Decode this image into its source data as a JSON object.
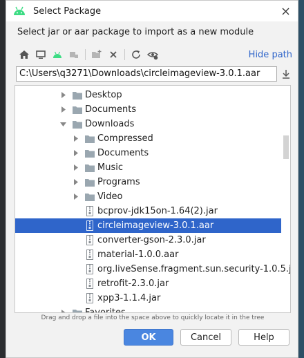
{
  "dialog": {
    "title": "Select Package",
    "instruction": "Select jar or aar package to import as a new module",
    "hide_path": "Hide path",
    "path": "C:\\Users\\q3271\\Downloads\\circleimageview-3.0.1.aar",
    "hint": "Drag and drop a file into the space above to quickly locate it in the tree"
  },
  "toolbar": {
    "icons": [
      "home-icon",
      "desktop-icon",
      "android-icon",
      "module-icon",
      "new-folder-icon",
      "delete-icon",
      "refresh-icon",
      "show-hidden-icon"
    ]
  },
  "tree": {
    "rows": [
      {
        "label": "Desktop",
        "kind": "folder",
        "expanded": false
      },
      {
        "label": "Documents",
        "kind": "folder",
        "expanded": false
      },
      {
        "label": "Downloads",
        "kind": "folder",
        "expanded": true
      },
      {
        "label": "Compressed",
        "kind": "folder",
        "expanded": false
      },
      {
        "label": "Documents",
        "kind": "folder",
        "expanded": false
      },
      {
        "label": "Music",
        "kind": "folder",
        "expanded": false
      },
      {
        "label": "Programs",
        "kind": "folder",
        "expanded": false
      },
      {
        "label": "Video",
        "kind": "folder",
        "expanded": false
      },
      {
        "label": "bcprov-jdk15on-1.64(2).jar",
        "kind": "file"
      },
      {
        "label": "circleimageview-3.0.1.aar",
        "kind": "file",
        "selected": true
      },
      {
        "label": "converter-gson-2.3.0.jar",
        "kind": "file"
      },
      {
        "label": "material-1.0.0.aar",
        "kind": "file"
      },
      {
        "label": "org.liveSense.fragment.sun.security-1.0.5.jar",
        "kind": "file"
      },
      {
        "label": "retrofit-2.3.0.jar",
        "kind": "file"
      },
      {
        "label": "xpp3-1.1.4.jar",
        "kind": "file"
      },
      {
        "label": "Favorites",
        "kind": "folder",
        "expanded": false
      }
    ]
  },
  "buttons": {
    "ok": "OK",
    "cancel": "Cancel",
    "help": "Help"
  },
  "colors": {
    "accent": "#2f65ca",
    "android_green": "#3ddc84",
    "folder": "#9aa7b0"
  }
}
